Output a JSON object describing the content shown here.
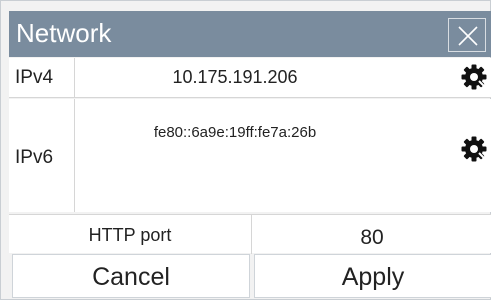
{
  "dialog": {
    "title": "Network",
    "close_icon": "close-icon"
  },
  "rows": {
    "ipv4": {
      "label": "IPv4",
      "value": "10.175.191.206",
      "icon": "gear-icon"
    },
    "ipv6": {
      "label": "IPv6",
      "value": "fe80::6a9e:19ff:fe7a:26b",
      "icon": "gear-icon"
    },
    "http": {
      "label": "HTTP port",
      "value": "80"
    }
  },
  "buttons": {
    "cancel_label": "Cancel",
    "apply_label": "Apply"
  },
  "colors": {
    "titlebar": "#7a8c9e",
    "background": "#f2f2f2"
  }
}
